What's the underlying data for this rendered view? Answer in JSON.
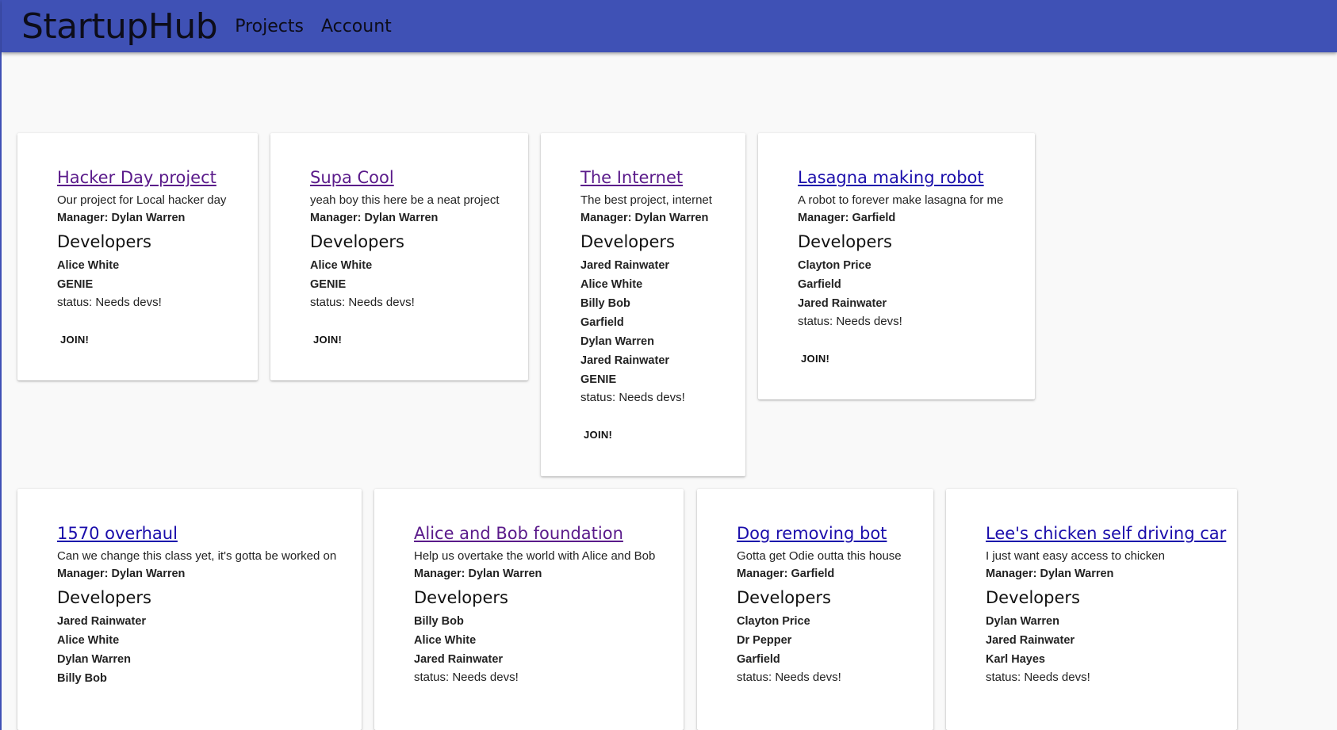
{
  "header": {
    "brand": "StartupHub",
    "nav": [
      "Projects",
      "Account"
    ]
  },
  "labels": {
    "developers_heading": "Developers",
    "join_button": "JOIN!"
  },
  "projects": [
    {
      "title": "Hacker Day project",
      "description": "Our project for Local hacker day",
      "manager": "Manager: Dylan Warren",
      "developers": [
        "Alice White",
        "GENIE"
      ],
      "status": "status: Needs devs!"
    },
    {
      "title": "Supa Cool",
      "description": "yeah boy this here be a neat project",
      "manager": "Manager: Dylan Warren",
      "developers": [
        "Alice White",
        "GENIE"
      ],
      "status": "status: Needs devs!"
    },
    {
      "title": "The Internet",
      "description": "The best project, internet",
      "manager": "Manager: Dylan Warren",
      "developers": [
        "Jared Rainwater",
        "Alice White",
        "Billy Bob",
        "Garfield",
        "Dylan Warren",
        "Jared Rainwater",
        "GENIE"
      ],
      "status": "status: Needs devs!"
    },
    {
      "title": "Lasagna making robot",
      "description": "A robot to forever make lasagna for me",
      "manager": "Manager: Garfield",
      "developers": [
        "Clayton Price",
        "Garfield",
        "Jared Rainwater"
      ],
      "status": "status: Needs devs!"
    },
    {
      "title": "1570 overhaul",
      "description": "Can we change this class yet, it's gotta be worked on",
      "manager": "Manager: Dylan Warren",
      "developers": [
        "Jared Rainwater",
        "Alice White",
        "Dylan Warren",
        "Billy Bob"
      ],
      "status": ""
    },
    {
      "title": "Alice and Bob foundation",
      "description": "Help us overtake the world with Alice and Bob",
      "manager": "Manager: Dylan Warren",
      "developers": [
        "Billy Bob",
        "Alice White",
        "Jared Rainwater"
      ],
      "status": "status: Needs devs!"
    },
    {
      "title": "Dog removing bot",
      "description": "Gotta get Odie outta this house",
      "manager": "Manager: Garfield",
      "developers": [
        "Clayton Price",
        "Dr Pepper",
        "Garfield"
      ],
      "status": "status: Needs devs!"
    },
    {
      "title": "Lee's chicken self driving car",
      "description": "I just want easy access to chicken",
      "manager": "Manager: Dylan Warren",
      "developers": [
        "Dylan Warren",
        "Jared Rainwater",
        "Karl Hayes"
      ],
      "status": "status: Needs devs!"
    }
  ]
}
